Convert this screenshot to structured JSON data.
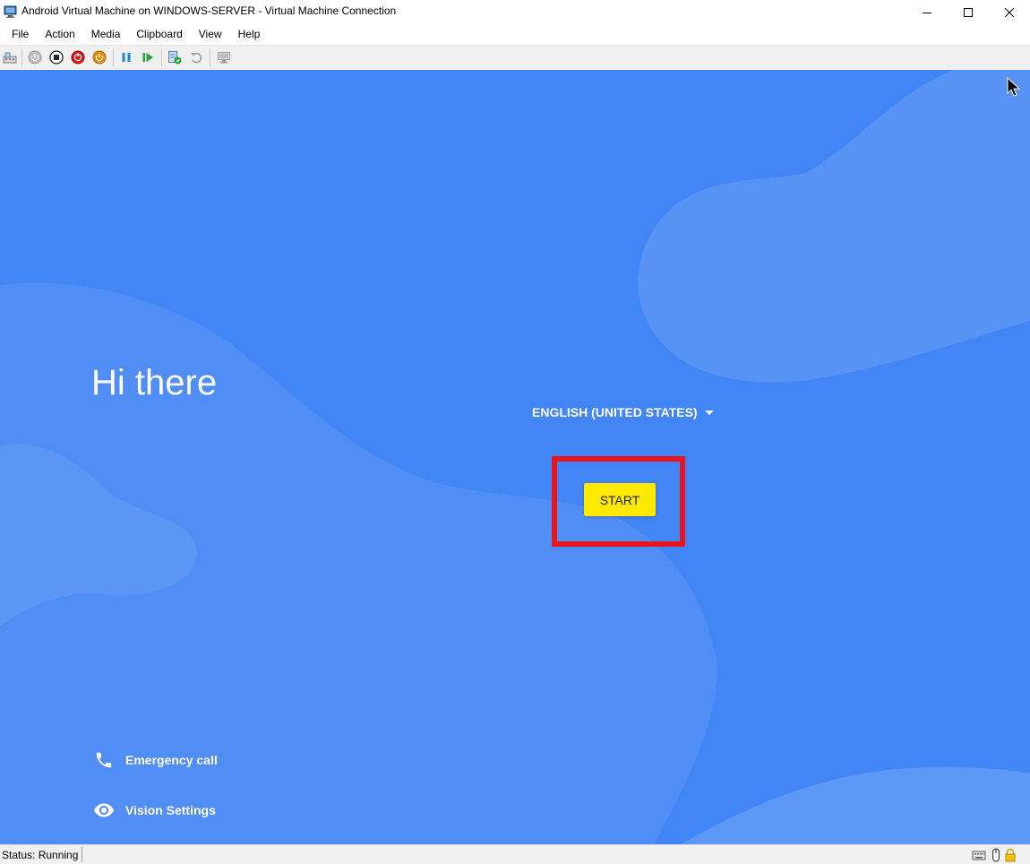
{
  "window": {
    "title": "Android Virtual Machine on WINDOWS-SERVER - Virtual Machine Connection",
    "app_icon": "vm-connection-icon",
    "controls": [
      "minimize-icon",
      "maximize-icon",
      "close-icon"
    ]
  },
  "menu": {
    "items": [
      {
        "label": "File"
      },
      {
        "label": "Action"
      },
      {
        "label": "Media"
      },
      {
        "label": "Clipboard"
      },
      {
        "label": "View"
      },
      {
        "label": "Help"
      }
    ]
  },
  "toolbar": {
    "buttons": [
      "ctrl-alt-del-icon",
      "start-icon",
      "turn-off-icon",
      "shut-down-icon",
      "save-icon",
      "pause-icon",
      "resume-icon",
      "checkpoint-icon",
      "revert-icon",
      "enhanced-session-icon"
    ]
  },
  "screen": {
    "background_color": "#4285f4",
    "greeting": "Hi there",
    "language": "ENGLISH (UNITED STATES)",
    "start_label": "START",
    "start_color": "#ffe900",
    "highlight_color": "#e8141e",
    "emergency_label": "Emergency call",
    "vision_label": "Vision Settings"
  },
  "status": {
    "text": "Status: Running",
    "icons": [
      "keyboard-icon",
      "mouse-icon",
      "lock-icon"
    ]
  }
}
